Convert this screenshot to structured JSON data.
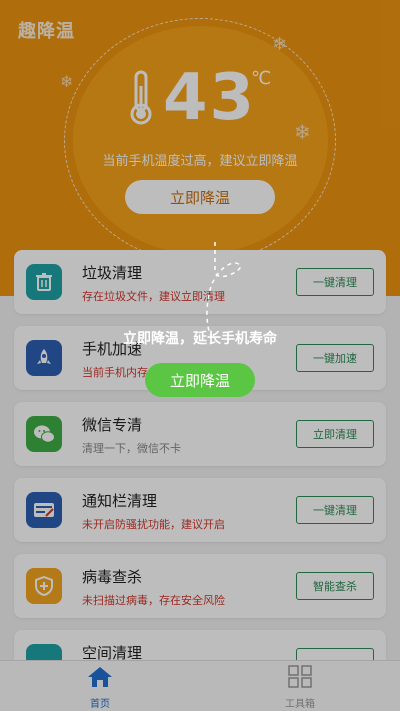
{
  "app": {
    "title": "趣降温"
  },
  "gauge": {
    "temperature": "43",
    "unit": "℃",
    "warning": "当前手机温度过高，建议立即降温",
    "button_label": "立即降温"
  },
  "items": [
    {
      "title": "垃圾清理",
      "subtitle": "存在垃圾文件，建议立即清理",
      "button": "一键清理",
      "icon": "trash-icon",
      "color": "#1fa3a8"
    },
    {
      "title": "手机加速",
      "subtitle": "当前手机内存占用过高",
      "button": "一键加速",
      "icon": "rocket-icon",
      "color": "#2d5fb3"
    },
    {
      "title": "微信专清",
      "subtitle": "清理一下，微信不卡",
      "button": "立即清理",
      "icon": "wechat-icon",
      "color": "#3fae45"
    },
    {
      "title": "通知栏清理",
      "subtitle": "未开启防骚扰功能，建议开启",
      "button": "一键清理",
      "icon": "notification-icon",
      "color": "#2d5fb3"
    },
    {
      "title": "病毒查杀",
      "subtitle": "未扫描过病毒，存在安全风险",
      "button": "智能查杀",
      "icon": "shield-icon",
      "color": "#f2a51f"
    },
    {
      "title": "空间清理",
      "subtitle": "",
      "button": "",
      "icon": "storage-icon",
      "color": "#1fa3a8"
    }
  ],
  "overlay": {
    "message": "立即降温，延长手机寿命",
    "button_label": "立即降温"
  },
  "bottom_nav": {
    "home_label": "首页",
    "tools_label": "工具箱",
    "active_color": "#1f6fd1"
  }
}
